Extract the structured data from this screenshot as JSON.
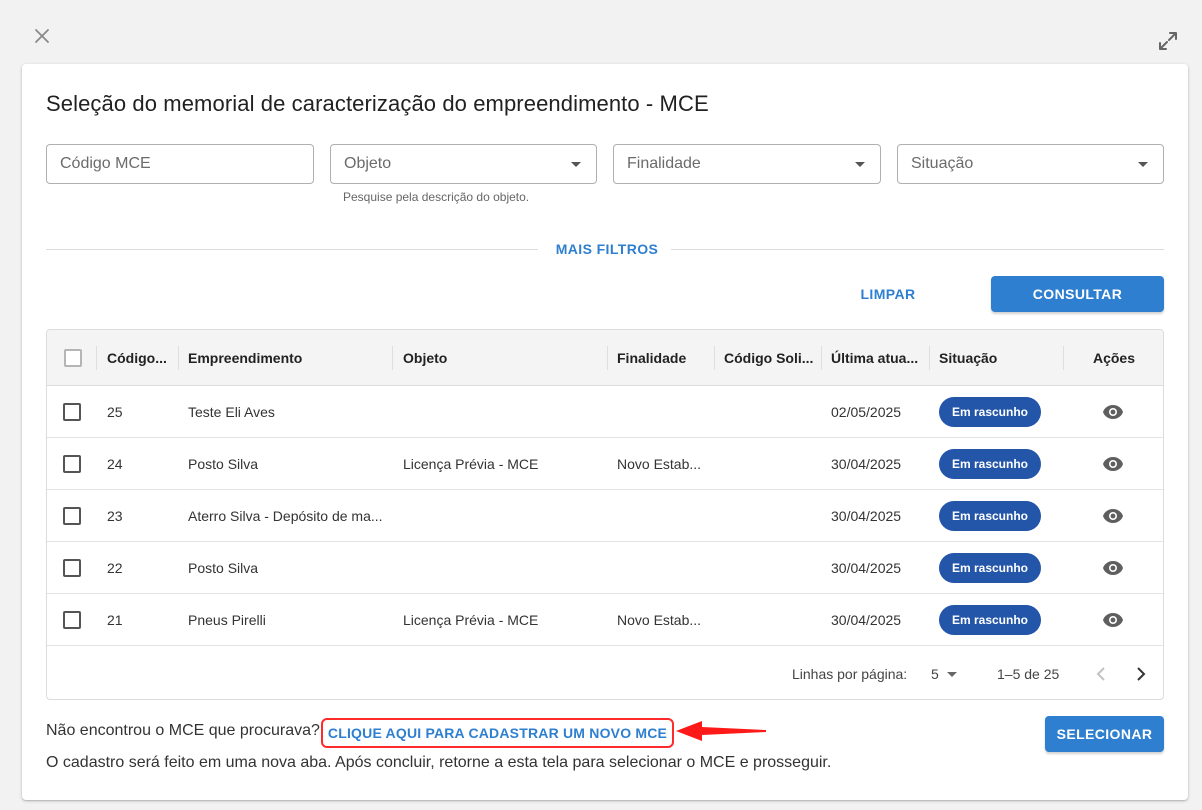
{
  "dialog": {
    "title": "Seleção do memorial de caracterização do empreendimento - MCE"
  },
  "filters": {
    "codigo_placeholder": "Código MCE",
    "objeto_placeholder": "Objeto",
    "objeto_hint": "Pesquise pela descrição do objeto.",
    "finalidade_placeholder": "Finalidade",
    "situacao_placeholder": "Situação",
    "mais_filtros": "MAIS FILTROS",
    "limpar": "LIMPAR",
    "consultar": "CONSULTAR"
  },
  "table": {
    "columns": [
      "Código...",
      "Empreendimento",
      "Objeto",
      "Finalidade",
      "Código Soli...",
      "Última atua...",
      "Situação",
      "Ações"
    ],
    "rows": [
      {
        "codigo": "25",
        "empreendimento": "Teste Eli Aves",
        "objeto": "",
        "finalidade": "",
        "codigo_solicitacao": "",
        "ultima_atualizacao": "02/05/2025",
        "situacao": "Em rascunho"
      },
      {
        "codigo": "24",
        "empreendimento": "Posto Silva",
        "objeto": "Licença Prévia - MCE",
        "finalidade": "Novo Estab...",
        "codigo_solicitacao": "",
        "ultima_atualizacao": "30/04/2025",
        "situacao": "Em rascunho"
      },
      {
        "codigo": "23",
        "empreendimento": "Aterro Silva - Depósito de ma...",
        "objeto": "",
        "finalidade": "",
        "codigo_solicitacao": "",
        "ultima_atualizacao": "30/04/2025",
        "situacao": "Em rascunho"
      },
      {
        "codigo": "22",
        "empreendimento": "Posto Silva",
        "objeto": "",
        "finalidade": "",
        "codigo_solicitacao": "",
        "ultima_atualizacao": "30/04/2025",
        "situacao": "Em rascunho"
      },
      {
        "codigo": "21",
        "empreendimento": "Pneus Pirelli",
        "objeto": "Licença Prévia - MCE",
        "finalidade": "Novo Estab...",
        "codigo_solicitacao": "",
        "ultima_atualizacao": "30/04/2025",
        "situacao": "Em rascunho"
      }
    ],
    "pagination": {
      "rows_per_page_label": "Linhas por página:",
      "rows_per_page": "5",
      "range": "1–5 de 25"
    }
  },
  "bottom": {
    "question": "Não encontrou o MCE que procurava?",
    "link": "CLIQUE AQUI PARA CADASTRAR UM NOVO MCE",
    "note": "O cadastro será feito em uma nova aba. Após concluir, retorne a esta tela para selecionar o MCE e prosseguir.",
    "selecionar": "SELECIONAR"
  },
  "colors": {
    "accent": "#2f7fd0",
    "badge": "#2356a8",
    "highlight": "#ff2a2a"
  },
  "icons": [
    "close-icon",
    "expand-icon",
    "dropdown-caret-icon",
    "eye-icon",
    "chevron-left-icon",
    "chevron-right-icon",
    "arrow-annotation-icon"
  ]
}
